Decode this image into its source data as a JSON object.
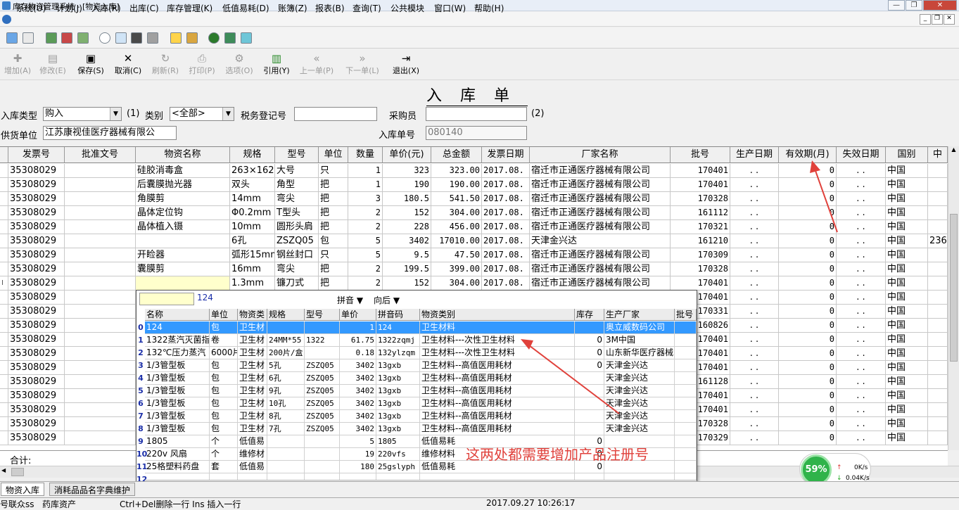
{
  "window": {
    "title": "库存物资管理系统 - [物资入库]"
  },
  "menu": [
    "系统(U)",
    "计划(J)",
    "入库(R)",
    "出库(C)",
    "库存管理(K)",
    "低值易耗(D)",
    "账簿(Z)",
    "报表(B)",
    "查询(T)",
    "公共模块",
    "窗口(W)",
    "帮助(H)"
  ],
  "toolbar": {
    "add": "增加(A)",
    "edit": "修改(E)",
    "save": "保存(S)",
    "cancel": "取消(C)",
    "refresh": "刷新(R)",
    "print": "打印(P)",
    "options": "选项(O)",
    "quote": "引用(Y)",
    "prev": "上一单(P)",
    "next": "下一单(L)",
    "exit": "退出(X)"
  },
  "form": {
    "title": "入库单",
    "type_label": "入库类型",
    "type_value": "购入",
    "hint1": "(1)",
    "cat_label": "类别",
    "cat_value": "<全部>",
    "tax_label": "税务登记号",
    "tax_value": "",
    "buyer_label": "采购员",
    "buyer_value": "",
    "hint2": "(2)",
    "supplier_label": "供货单位",
    "supplier_value": "江苏康视佳医疗器械有限公",
    "no_label": "入库单号",
    "no_value": "080140"
  },
  "grid": {
    "headers": [
      "发票号",
      "批准文号",
      "物资名称",
      "规格",
      "型号",
      "单位",
      "数量",
      "单价(元)",
      "总金额",
      "发票日期",
      "厂家名称",
      "批号",
      "生产日期",
      "有效期(月)",
      "失效日期",
      "国别",
      "中"
    ],
    "rows": [
      {
        "inv": "35308029",
        "name": "硅胶消毒盒",
        "spec": "263×162",
        "model": "大号",
        "unit": "只",
        "qty": "1",
        "price": "323",
        "total": "323.00",
        "date": "2017.08.",
        "maker": "宿迁市正通医疗器械有限公司",
        "batch": "170401",
        "mfg": ". .",
        "exp": "0",
        "fail": ". .",
        "country": "中国",
        "extra": ""
      },
      {
        "inv": "35308029",
        "name": "后囊膜抛光器",
        "spec": "双头",
        "model": "角型",
        "unit": "把",
        "qty": "1",
        "price": "190",
        "total": "190.00",
        "date": "2017.08.",
        "maker": "宿迁市正通医疗器械有限公司",
        "batch": "170401",
        "mfg": ". .",
        "exp": "0",
        "fail": ". .",
        "country": "中国",
        "extra": ""
      },
      {
        "inv": "35308029",
        "name": "角膜剪",
        "spec": "14mm",
        "model": "弯尖",
        "unit": "把",
        "qty": "3",
        "price": "180.5",
        "total": "541.50",
        "date": "2017.08.",
        "maker": "宿迁市正通医疗器械有限公司",
        "batch": "170328",
        "mfg": ". .",
        "exp": "0",
        "fail": ". .",
        "country": "中国",
        "extra": ""
      },
      {
        "inv": "35308029",
        "name": "晶体定位钩",
        "spec": "Φ0.2mm",
        "model": "T型头",
        "unit": "把",
        "qty": "2",
        "price": "152",
        "total": "304.00",
        "date": "2017.08.",
        "maker": "宿迁市正通医疗器械有限公司",
        "batch": "161112",
        "mfg": ". .",
        "exp": "0",
        "fail": ". .",
        "country": "中国",
        "extra": ""
      },
      {
        "inv": "35308029",
        "name": "晶体植入镊",
        "spec": "10mm",
        "model": "圆形头肩",
        "unit": "把",
        "qty": "2",
        "price": "228",
        "total": "456.00",
        "date": "2017.08.",
        "maker": "宿迁市正通医疗器械有限公司",
        "batch": "170321",
        "mfg": ". .",
        "exp": "0",
        "fail": ". .",
        "country": "中国",
        "extra": ""
      },
      {
        "inv": "35308029",
        "name": "",
        "spec": "6孔",
        "model": "ZSZQ05",
        "unit": "包",
        "qty": "5",
        "price": "3402",
        "total": "17010.00",
        "date": "2017.08.",
        "maker": "天津金兴达",
        "batch": "161210",
        "mfg": ". .",
        "exp": "0",
        "fail": ". .",
        "country": "中国",
        "extra": "236"
      },
      {
        "inv": "35308029",
        "name": "开睑器",
        "spec": "弧形15mm",
        "model": "钢丝封口",
        "unit": "只",
        "qty": "5",
        "price": "9.5",
        "total": "47.50",
        "date": "2017.08.",
        "maker": "宿迁市正通医疗器械有限公司",
        "batch": "170309",
        "mfg": ". .",
        "exp": "0",
        "fail": ". .",
        "country": "中国",
        "extra": ""
      },
      {
        "inv": "35308029",
        "name": "囊膜剪",
        "spec": "16mm",
        "model": "弯尖",
        "unit": "把",
        "qty": "2",
        "price": "199.5",
        "total": "399.00",
        "date": "2017.08.",
        "maker": "宿迁市正通医疗器械有限公司",
        "batch": "170328",
        "mfg": ". .",
        "exp": "0",
        "fail": ". .",
        "country": "中国",
        "extra": ""
      },
      {
        "inv": "35308029",
        "name": "",
        "spec": "1.3mm",
        "model": "镰刀式",
        "unit": "把",
        "qty": "2",
        "price": "152",
        "total": "304.00",
        "date": "2017.08.",
        "maker": "宿迁市正通医疗器械有限公司",
        "batch": "170401",
        "mfg": ". .",
        "exp": "0",
        "fail": ". .",
        "country": "中国",
        "extra": ""
      },
      {
        "inv": "35308029",
        "name": "",
        "spec": "",
        "model": "",
        "unit": "",
        "qty": "",
        "price": "",
        "total": "",
        "date": "",
        "maker": "",
        "batch": "170401",
        "mfg": ". .",
        "exp": "0",
        "fail": ". .",
        "country": "中国",
        "extra": ""
      },
      {
        "inv": "35308029",
        "name": "",
        "spec": "",
        "model": "",
        "unit": "",
        "qty": "",
        "price": "",
        "total": "",
        "date": "",
        "maker": "",
        "batch": "170331",
        "mfg": ". .",
        "exp": "0",
        "fail": ". .",
        "country": "中国",
        "extra": ""
      },
      {
        "inv": "35308029",
        "name": "",
        "spec": "",
        "model": "",
        "unit": "",
        "qty": "",
        "price": "",
        "total": "",
        "date": "",
        "maker": "",
        "batch": "160826",
        "mfg": ". .",
        "exp": "0",
        "fail": ". .",
        "country": "中国",
        "extra": ""
      },
      {
        "inv": "35308029",
        "name": "",
        "spec": "",
        "model": "",
        "unit": "",
        "qty": "",
        "price": "",
        "total": "",
        "date": "",
        "maker": "",
        "batch": "170401",
        "mfg": ". .",
        "exp": "0",
        "fail": ". .",
        "country": "中国",
        "extra": ""
      },
      {
        "inv": "35308029",
        "name": "",
        "spec": "",
        "model": "",
        "unit": "",
        "qty": "",
        "price": "",
        "total": "",
        "date": "",
        "maker": "",
        "batch": "170401",
        "mfg": ". .",
        "exp": "0",
        "fail": ". .",
        "country": "中国",
        "extra": ""
      },
      {
        "inv": "35308029",
        "name": "",
        "spec": "",
        "model": "",
        "unit": "",
        "qty": "",
        "price": "",
        "total": "",
        "date": "",
        "maker": "",
        "batch": "170401",
        "mfg": ". .",
        "exp": "0",
        "fail": ". .",
        "country": "中国",
        "extra": ""
      },
      {
        "inv": "35308029",
        "name": "",
        "spec": "",
        "model": "",
        "unit": "",
        "qty": "",
        "price": "",
        "total": "",
        "date": "",
        "maker": "",
        "batch": "161128",
        "mfg": ". .",
        "exp": "0",
        "fail": ". .",
        "country": "中国",
        "extra": ""
      },
      {
        "inv": "35308029",
        "name": "",
        "spec": "",
        "model": "",
        "unit": "",
        "qty": "",
        "price": "",
        "total": "",
        "date": "",
        "maker": "",
        "batch": "170401",
        "mfg": ". .",
        "exp": "0",
        "fail": ". .",
        "country": "中国",
        "extra": ""
      },
      {
        "inv": "35308029",
        "name": "",
        "spec": "",
        "model": "",
        "unit": "",
        "qty": "",
        "price": "",
        "total": "",
        "date": "",
        "maker": "",
        "batch": "170401",
        "mfg": ". .",
        "exp": "0",
        "fail": ". .",
        "country": "中国",
        "extra": ""
      },
      {
        "inv": "35308029",
        "name": "",
        "spec": "",
        "model": "",
        "unit": "",
        "qty": "",
        "price": "",
        "total": "",
        "date": "",
        "maker": "",
        "batch": "170328",
        "mfg": ". .",
        "exp": "0",
        "fail": ". .",
        "country": "中国",
        "extra": ""
      },
      {
        "inv": "35308029",
        "name": "",
        "spec": "",
        "model": "",
        "unit": "",
        "qty": "",
        "price": "",
        "total": "",
        "date": "",
        "maker": "",
        "batch": "170329",
        "mfg": ". .",
        "exp": "0",
        "fail": ". .",
        "country": "中国",
        "extra": ""
      }
    ],
    "sum_label": "合计:"
  },
  "popup": {
    "search_value": "124",
    "pinyin": "拼音",
    "direction": "向后",
    "headers": [
      "名称",
      "单位",
      "物资类",
      "规格",
      "型号",
      "单价",
      "拼音码",
      "物资类别",
      "库存",
      "生产厂家",
      "批号"
    ],
    "rows": [
      {
        "no": "0",
        "name": "124",
        "unit": "包",
        "cls": "卫生材",
        "spec": "",
        "model": "",
        "price": "1",
        "py": "124",
        "cat": "卫生材料",
        "stock": "",
        "maker": "奥立威数码公司"
      },
      {
        "no": "1",
        "name": "1322蒸汽灭菌指",
        "unit": "卷",
        "cls": "卫生材",
        "spec": "24MM*55",
        "model": "1322",
        "price": "61.75",
        "py": "1322zqmj",
        "cat": "卫生材料---次性卫生材料",
        "stock": "0",
        "maker": "3M中国"
      },
      {
        "no": "2",
        "name": "132℃压力蒸汽",
        "unit": "6000片",
        "cls": "卫生材",
        "spec": "200片/盒",
        "model": "",
        "price": "0.18",
        "py": "132ylzqm",
        "cat": "卫生材料---次性卫生材料",
        "stock": "0",
        "maker": "山东新华医疗器械"
      },
      {
        "no": "3",
        "name": "1/3管型板",
        "unit": "包",
        "cls": "卫生材",
        "spec": "5孔",
        "model": "ZSZQ05",
        "price": "3402",
        "py": "13gxb",
        "cat": "卫生材料--高值医用耗材",
        "stock": "0",
        "maker": "天津金兴达"
      },
      {
        "no": "4",
        "name": "1/3管型板",
        "unit": "包",
        "cls": "卫生材",
        "spec": "6孔",
        "model": "ZSZQ05",
        "price": "3402",
        "py": "13gxb",
        "cat": "卫生材料--高值医用耗材",
        "stock": "",
        "maker": "天津金兴达"
      },
      {
        "no": "5",
        "name": "1/3管型板",
        "unit": "包",
        "cls": "卫生材",
        "spec": "9孔",
        "model": "ZSZQ05",
        "price": "3402",
        "py": "13gxb",
        "cat": "卫生材料--高值医用耗材",
        "stock": "",
        "maker": "天津金兴达"
      },
      {
        "no": "6",
        "name": "1/3管型板",
        "unit": "包",
        "cls": "卫生材",
        "spec": "10孔",
        "model": "ZSZQ05",
        "price": "3402",
        "py": "13gxb",
        "cat": "卫生材料--高值医用耗材",
        "stock": "",
        "maker": "天津金兴达"
      },
      {
        "no": "7",
        "name": "1/3管型板",
        "unit": "包",
        "cls": "卫生材",
        "spec": "8孔",
        "model": "ZSZQ05",
        "price": "3402",
        "py": "13gxb",
        "cat": "卫生材料--高值医用耗材",
        "stock": "",
        "maker": "天津金兴达"
      },
      {
        "no": "8",
        "name": "1/3管型板",
        "unit": "包",
        "cls": "卫生材",
        "spec": "7孔",
        "model": "ZSZQ05",
        "price": "3402",
        "py": "13gxb",
        "cat": "卫生材料--高值医用耗材",
        "stock": "",
        "maker": "天津金兴达"
      },
      {
        "no": "9",
        "name": "1805",
        "unit": "个",
        "cls": "低值易",
        "spec": "",
        "model": "",
        "price": "5",
        "py": "1805",
        "cat": "低值易耗",
        "stock": "0",
        "maker": ""
      },
      {
        "no": "10",
        "name": "220v 风扇",
        "unit": "个",
        "cls": "维修材",
        "spec": "",
        "model": "",
        "price": "19",
        "py": "220vfs",
        "cat": "维修材料",
        "stock": "0",
        "maker": ""
      },
      {
        "no": "11",
        "name": "25格塑料药盘",
        "unit": "套",
        "cls": "低值易",
        "spec": "",
        "model": "",
        "price": "180",
        "py": "25gslyph",
        "cat": "低值易耗",
        "stock": "0",
        "maker": ""
      },
      {
        "no": "12",
        "name": "",
        "unit": "",
        "cls": "",
        "spec": "",
        "model": "",
        "price": "",
        "py": "",
        "cat": "",
        "stock": "",
        "maker": ""
      }
    ]
  },
  "annotation": "这两处都需要增加产品注册号",
  "tabs": [
    "物资入库",
    "消耗品品名字典维护"
  ],
  "status": {
    "user": "号联众ss",
    "dept": "药库资产",
    "hint": "Ctrl+Del删除一行  Ins 插入一行",
    "time": "2017.09.27 10:26:17"
  },
  "net": {
    "percent": "59%",
    "up": "0K/s",
    "down": "0.04K/s"
  },
  "colors": {
    "selected": "#3399ff",
    "annotation": "#e0413b",
    "net_green": "#2fb34a"
  }
}
